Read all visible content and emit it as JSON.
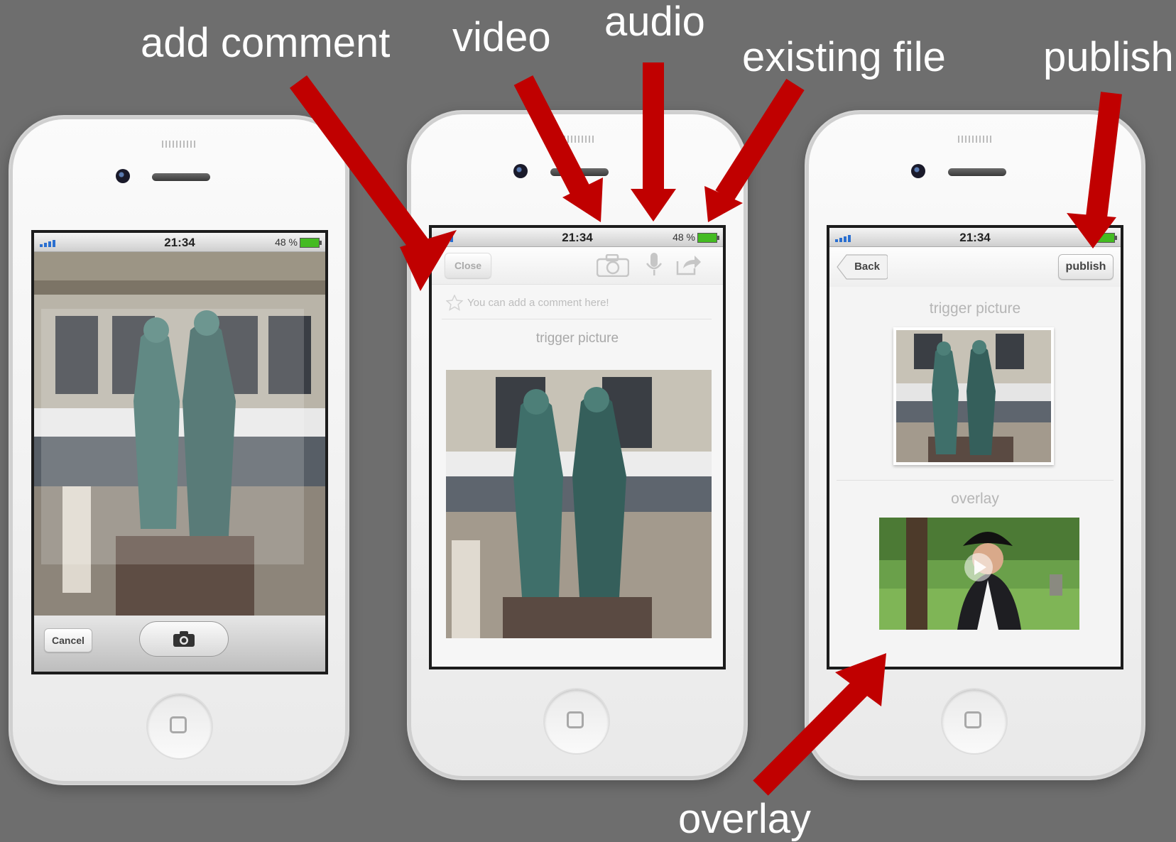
{
  "labels": {
    "add_comment": "add comment",
    "video": "video",
    "audio": "audio",
    "existing_file": "existing file",
    "publish": "publish",
    "overlay": "overlay"
  },
  "colors": {
    "background": "#6e6e6e",
    "arrow": "#c00000",
    "battery": "#44bb22"
  },
  "phone1": {
    "status": {
      "time": "21:34",
      "battery": "48 %"
    },
    "camera_toolbar": {
      "cancel": "Cancel",
      "shutter_icon": "camera-icon"
    }
  },
  "phone2": {
    "status": {
      "time": "21:34",
      "battery": "48 %"
    },
    "toolbar": {
      "close": "Close",
      "icons": [
        "camera-icon",
        "microphone-icon",
        "share-icon"
      ]
    },
    "comment_placeholder": "You can add a comment here!",
    "trigger_caption": "trigger picture"
  },
  "phone3": {
    "status": {
      "time": "21:34"
    },
    "navbar": {
      "back": "Back",
      "publish": "publish"
    },
    "trigger_caption": "trigger picture",
    "overlay_caption": "overlay",
    "play_icon": "play-icon"
  }
}
